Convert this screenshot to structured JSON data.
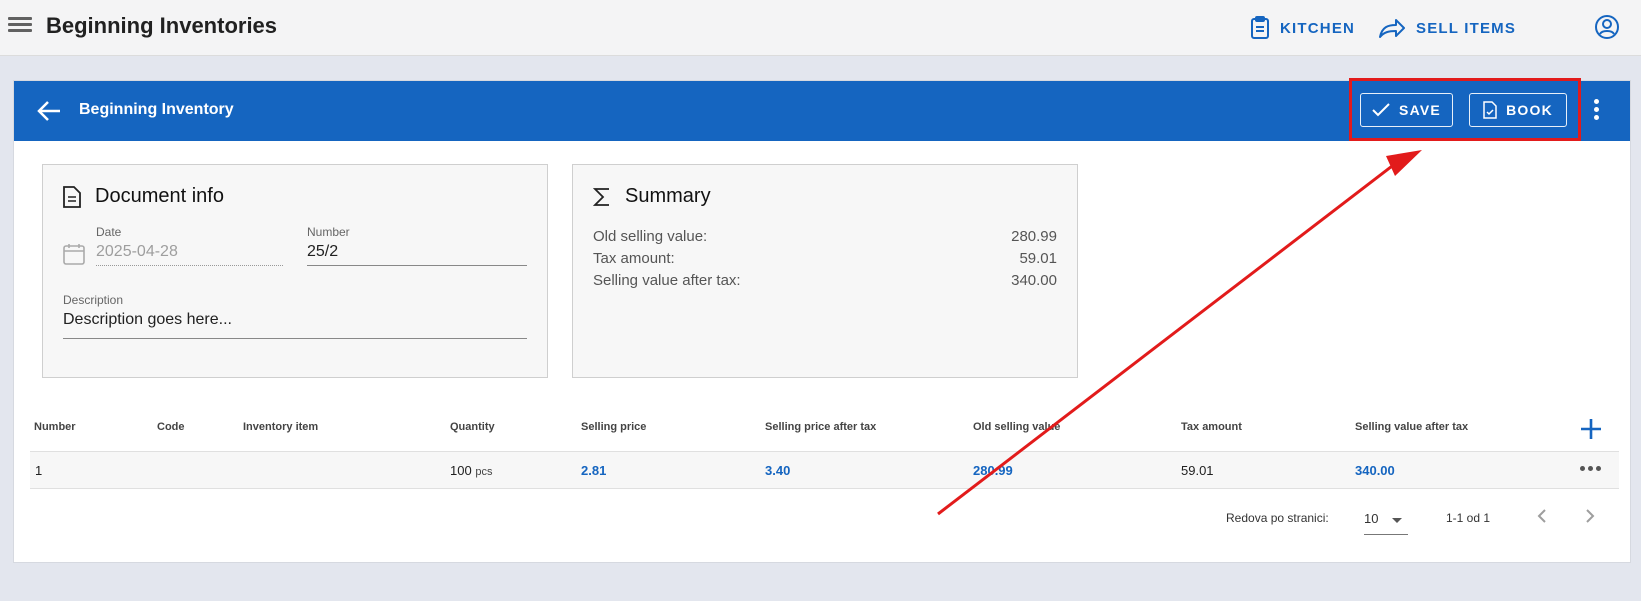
{
  "appbar": {
    "title": "Beginning Inventories",
    "kitchen_label": "KITCHEN",
    "sell_items_label": "SELL ITEMS"
  },
  "header": {
    "title": "Beginning Inventory",
    "save_label": "SAVE",
    "book_label": "BOOK"
  },
  "document_info": {
    "title": "Document info",
    "date_label": "Date",
    "date_value": "2025-04-28",
    "number_label": "Number",
    "number_value": "25/2",
    "description_label": "Description",
    "description_value": "Description goes here..."
  },
  "summary": {
    "title": "Summary",
    "rows": [
      {
        "label": "Old selling value:",
        "value": "280.99"
      },
      {
        "label": "Tax amount:",
        "value": "59.01"
      },
      {
        "label": "Selling value after tax:",
        "value": "340.00"
      }
    ]
  },
  "table": {
    "columns": [
      "Number",
      "Code",
      "Inventory item",
      "Quantity",
      "Selling price",
      "Selling price after tax",
      "Old selling value",
      "Tax amount",
      "Selling value after tax"
    ],
    "rows": [
      {
        "number": "1",
        "code": "",
        "item": "",
        "quantity": "100",
        "unit": "pcs",
        "selling_price": "2.81",
        "selling_price_after_tax": "3.40",
        "old_selling_value": "280.99",
        "tax_amount": "59.01",
        "selling_value_after_tax": "340.00"
      }
    ]
  },
  "pagination": {
    "rows_per_page_label": "Redova po stranici:",
    "rows_per_page": "10",
    "range": "1-1 od 1"
  },
  "colors": {
    "primary": "#1565c0",
    "annotation": "#e21b1b"
  },
  "icons": [
    "menu-icon",
    "clipboard-icon",
    "share-icon",
    "account-circle-icon",
    "arrow-left-icon",
    "check-icon",
    "document-check-icon",
    "more-vert-icon",
    "document-icon",
    "calendar-icon",
    "sigma-icon",
    "plus-icon",
    "more-horiz-icon",
    "chevron-left-icon",
    "chevron-right-icon"
  ]
}
